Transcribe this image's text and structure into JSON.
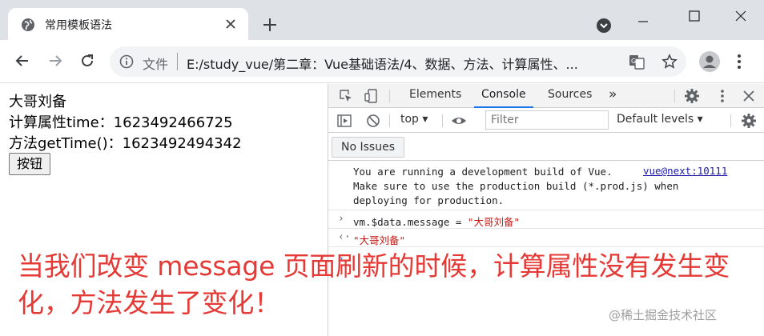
{
  "browser": {
    "tab": {
      "title": "常用模板语法",
      "favicon_icon": "globe-icon",
      "close_icon": "close-icon"
    },
    "new_tab_icon": "plus-icon",
    "tab_search_icon": "chevron-down-circle-icon",
    "window_controls": [
      "minimize-icon",
      "maximize-icon",
      "close-icon"
    ],
    "nav": {
      "back_icon": "arrow-left-icon",
      "forward_icon": "arrow-right-icon",
      "reload_icon": "reload-icon"
    },
    "address": {
      "scheme_label": "文件",
      "url": "E:/study_vue/第二章：Vue基础语法/4、数据、方法、计算属性、..."
    }
  },
  "page": {
    "lines": [
      "大哥刘备",
      "计算属性time：1623492466725",
      "方法getTime()：1623492494342"
    ],
    "button_label": "按钮"
  },
  "devtools": {
    "tabs": [
      "Elements",
      "Console",
      "Sources"
    ],
    "active_tab": "Console",
    "more_tabs": "»",
    "context": "top",
    "filter_placeholder": "Filter",
    "levels_label": "Default levels",
    "issues_label": "No Issues",
    "console": {
      "info_text": "You are running a development build of Vue. \nMake sure to use the production build (*.prod.js) when\ndeploying for production.",
      "info_link": "vue@next:10111",
      "input_prefix": "vm.$data.message = ",
      "input_string": "\"大哥刘备\"",
      "output_string": "\"大哥刘备\""
    }
  },
  "annotation": {
    "text": "当我们改变 message 页面刷新的时候，计算属性没有发生变化，方法发生了变化！",
    "color": "#e53935"
  },
  "watermark": "@稀土掘金技术社区"
}
